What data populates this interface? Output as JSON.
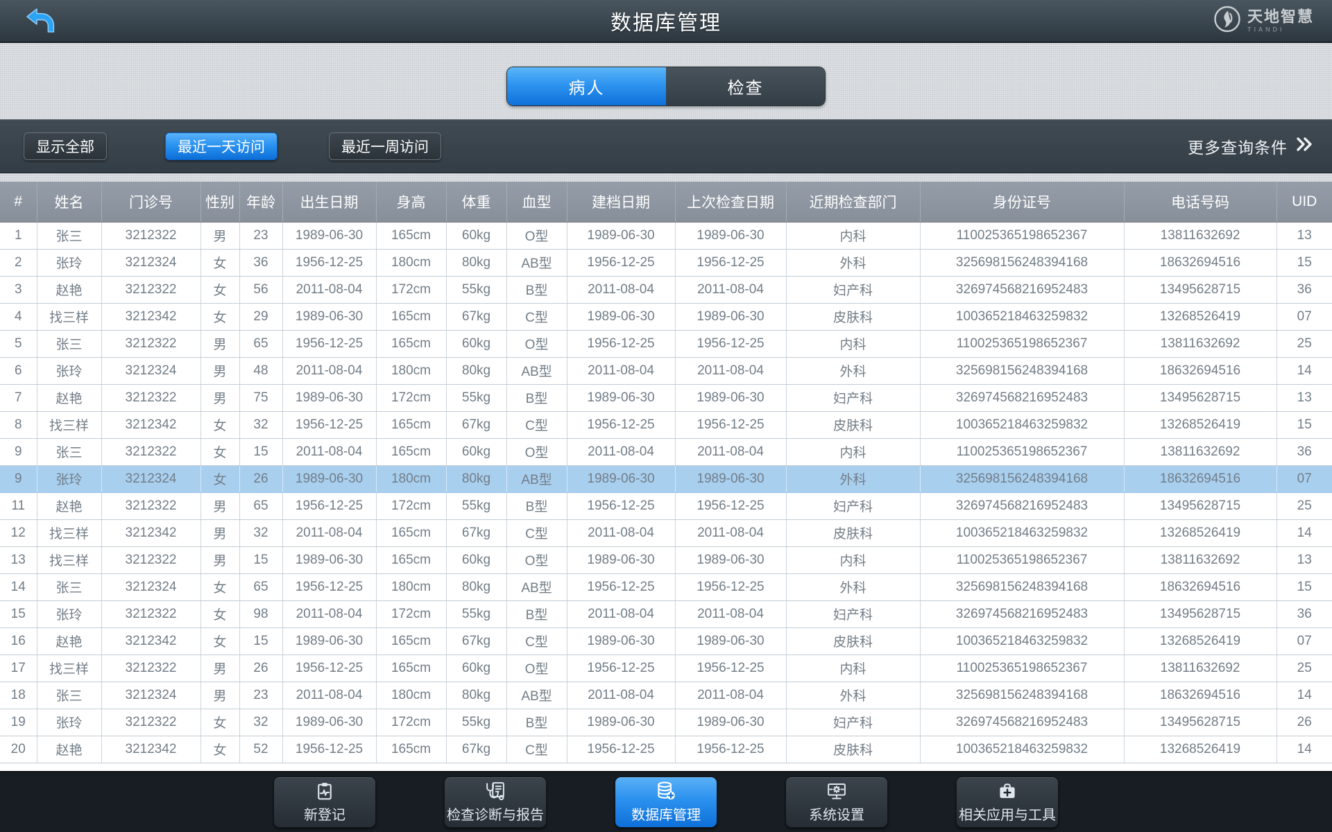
{
  "app": {
    "title": "数据库管理",
    "brand": {
      "name": "天地智慧",
      "sub": "TIANDI"
    }
  },
  "tabs": [
    {
      "label": "病人",
      "active": true
    },
    {
      "label": "检查",
      "active": false
    }
  ],
  "filters": {
    "buttons": [
      {
        "label": "显示全部",
        "active": false
      },
      {
        "label": "最近一天访问",
        "active": true
      },
      {
        "label": "最近一周访问",
        "active": false
      }
    ],
    "more_label": "更多查询条件"
  },
  "table": {
    "columns": [
      "#",
      "姓名",
      "门诊号",
      "性别",
      "年龄",
      "出生日期",
      "身高",
      "体重",
      "血型",
      "建档日期",
      "上次检查日期",
      "近期检查部门",
      "身份证号",
      "电话号码",
      "UID"
    ],
    "selected_row_index": 9,
    "rows": [
      [
        "1",
        "张三",
        "3212322",
        "男",
        "23",
        "1989-06-30",
        "165cm",
        "60kg",
        "O型",
        "1989-06-30",
        "1989-06-30",
        "内科",
        "110025365198652367",
        "13811632692",
        "13"
      ],
      [
        "2",
        "张玲",
        "3212324",
        "女",
        "36",
        "1956-12-25",
        "180cm",
        "80kg",
        "AB型",
        "1956-12-25",
        "1956-12-25",
        "外科",
        "325698156248394168",
        "18632694516",
        "15"
      ],
      [
        "3",
        "赵艳",
        "3212322",
        "女",
        "56",
        "2011-08-04",
        "172cm",
        "55kg",
        "B型",
        "2011-08-04",
        "2011-08-04",
        "妇产科",
        "326974568216952483",
        "13495628715",
        "36"
      ],
      [
        "4",
        "找三样",
        "3212342",
        "女",
        "29",
        "1989-06-30",
        "165cm",
        "67kg",
        "C型",
        "1989-06-30",
        "1989-06-30",
        "皮肤科",
        "100365218463259832",
        "13268526419",
        "07"
      ],
      [
        "5",
        "张三",
        "3212322",
        "男",
        "65",
        "1956-12-25",
        "165cm",
        "60kg",
        "O型",
        "1956-12-25",
        "1956-12-25",
        "内科",
        "110025365198652367",
        "13811632692",
        "25"
      ],
      [
        "6",
        "张玲",
        "3212324",
        "男",
        "48",
        "2011-08-04",
        "180cm",
        "80kg",
        "AB型",
        "2011-08-04",
        "2011-08-04",
        "外科",
        "325698156248394168",
        "18632694516",
        "14"
      ],
      [
        "7",
        "赵艳",
        "3212322",
        "男",
        "75",
        "1989-06-30",
        "172cm",
        "55kg",
        "B型",
        "1989-06-30",
        "1989-06-30",
        "妇产科",
        "326974568216952483",
        "13495628715",
        "13"
      ],
      [
        "8",
        "找三样",
        "3212342",
        "女",
        "32",
        "1956-12-25",
        "165cm",
        "67kg",
        "C型",
        "1956-12-25",
        "1956-12-25",
        "皮肤科",
        "100365218463259832",
        "13268526419",
        "15"
      ],
      [
        "9",
        "张三",
        "3212322",
        "女",
        "15",
        "2011-08-04",
        "165cm",
        "60kg",
        "O型",
        "2011-08-04",
        "2011-08-04",
        "内科",
        "110025365198652367",
        "13811632692",
        "36"
      ],
      [
        "9",
        "张玲",
        "3212324",
        "女",
        "26",
        "1989-06-30",
        "180cm",
        "80kg",
        "AB型",
        "1989-06-30",
        "1989-06-30",
        "外科",
        "325698156248394168",
        "18632694516",
        "07"
      ],
      [
        "11",
        "赵艳",
        "3212322",
        "男",
        "65",
        "1956-12-25",
        "172cm",
        "55kg",
        "B型",
        "1956-12-25",
        "1956-12-25",
        "妇产科",
        "326974568216952483",
        "13495628715",
        "25"
      ],
      [
        "12",
        "找三样",
        "3212342",
        "男",
        "32",
        "2011-08-04",
        "165cm",
        "67kg",
        "C型",
        "2011-08-04",
        "2011-08-04",
        "皮肤科",
        "100365218463259832",
        "13268526419",
        "14"
      ],
      [
        "13",
        "找三样",
        "3212322",
        "男",
        "15",
        "1989-06-30",
        "165cm",
        "60kg",
        "O型",
        "1989-06-30",
        "1989-06-30",
        "内科",
        "110025365198652367",
        "13811632692",
        "13"
      ],
      [
        "14",
        "张三",
        "3212324",
        "女",
        "65",
        "1956-12-25",
        "180cm",
        "80kg",
        "AB型",
        "1956-12-25",
        "1956-12-25",
        "外科",
        "325698156248394168",
        "18632694516",
        "15"
      ],
      [
        "15",
        "张玲",
        "3212322",
        "女",
        "98",
        "2011-08-04",
        "172cm",
        "55kg",
        "B型",
        "2011-08-04",
        "2011-08-04",
        "妇产科",
        "326974568216952483",
        "13495628715",
        "36"
      ],
      [
        "16",
        "赵艳",
        "3212342",
        "女",
        "15",
        "1989-06-30",
        "165cm",
        "67kg",
        "C型",
        "1989-06-30",
        "1989-06-30",
        "皮肤科",
        "100365218463259832",
        "13268526419",
        "07"
      ],
      [
        "17",
        "找三样",
        "3212322",
        "男",
        "26",
        "1956-12-25",
        "165cm",
        "60kg",
        "O型",
        "1956-12-25",
        "1956-12-25",
        "内科",
        "110025365198652367",
        "13811632692",
        "25"
      ],
      [
        "18",
        "张三",
        "3212324",
        "男",
        "23",
        "2011-08-04",
        "180cm",
        "80kg",
        "AB型",
        "2011-08-04",
        "2011-08-04",
        "外科",
        "325698156248394168",
        "18632694516",
        "14"
      ],
      [
        "19",
        "张玲",
        "3212322",
        "女",
        "32",
        "1989-06-30",
        "172cm",
        "55kg",
        "B型",
        "1989-06-30",
        "1989-06-30",
        "妇产科",
        "326974568216952483",
        "13495628715",
        "26"
      ],
      [
        "20",
        "赵艳",
        "3212342",
        "女",
        "52",
        "1956-12-25",
        "165cm",
        "67kg",
        "C型",
        "1956-12-25",
        "1956-12-25",
        "皮肤科",
        "100365218463259832",
        "13268526419",
        "14"
      ]
    ]
  },
  "bottom_nav": [
    {
      "label": "新登记",
      "icon": "clipboard-pulse-icon",
      "active": false
    },
    {
      "label": "检查诊断与报告",
      "icon": "stethoscope-report-icon",
      "active": false
    },
    {
      "label": "数据库管理",
      "icon": "database-medical-icon",
      "active": true
    },
    {
      "label": "系统设置",
      "icon": "monitor-gear-icon",
      "active": false
    },
    {
      "label": "相关应用与工具",
      "icon": "medical-kit-icon",
      "active": false
    }
  ],
  "colors": {
    "accent_blue": "#2b93f0",
    "selected_row": "#a9cfef",
    "table_header": "#8c949f",
    "dark_bar": "#39434b",
    "footer_bg": "#171d22"
  }
}
